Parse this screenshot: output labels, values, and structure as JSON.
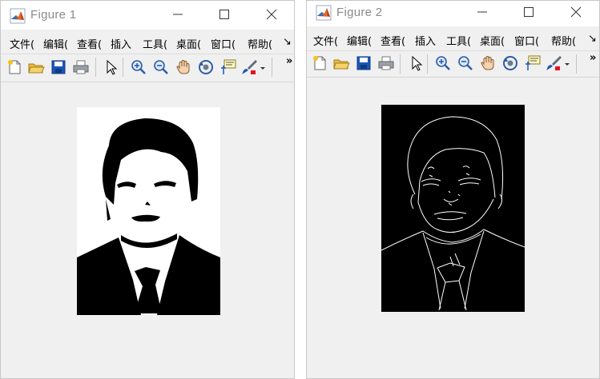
{
  "windows": [
    {
      "title": "Figure 1",
      "menus": [
        "文件(",
        "编辑(",
        "查看(",
        "插入",
        "工具(",
        "桌面(",
        "窗口(",
        "帮助("
      ],
      "menu_overflow": "↘",
      "toolbar_overflow": "»",
      "image": "binary-portrait"
    },
    {
      "title": "Figure 2",
      "menus": [
        "文件(",
        "编辑(",
        "查看(",
        "插入",
        "工具(",
        "桌面(",
        "窗口(",
        "帮助("
      ],
      "menu_overflow": "↘",
      "toolbar_overflow": "»",
      "image": "edge-portrait"
    }
  ],
  "toolbar_icons": [
    "new-figure-icon",
    "open-file-icon",
    "save-icon",
    "print-icon",
    "select-arrow-icon",
    "zoom-in-icon",
    "zoom-out-icon",
    "pan-hand-icon",
    "rotate-3d-icon",
    "data-cursor-icon",
    "brush-icon"
  ],
  "colors": {
    "window_bg": "#f0f0f0",
    "title_text": "#8a8a8a",
    "accent_red": "#e81123",
    "icon_blue": "#1a56b8"
  }
}
